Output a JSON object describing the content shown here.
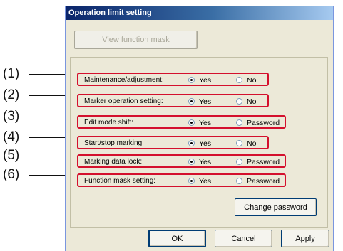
{
  "window": {
    "title": "Operation limit setting"
  },
  "toolbar": {
    "view_function_mask_label": "View function mask"
  },
  "callouts": [
    "(1)",
    "(2)",
    "(3)",
    "(4)",
    "(5)",
    "(6)"
  ],
  "settings": [
    {
      "label": "Maintenance/adjustment:",
      "option_yes": "Yes",
      "option_alt": "No",
      "selected": "Yes"
    },
    {
      "label": "Marker operation setting:",
      "option_yes": "Yes",
      "option_alt": "No",
      "selected": "Yes"
    },
    {
      "label": "Edit mode shift:",
      "option_yes": "Yes",
      "option_alt": "Password",
      "selected": "Yes"
    },
    {
      "label": "Start/stop marking:",
      "option_yes": "Yes",
      "option_alt": "No",
      "selected": "Yes"
    },
    {
      "label": "Marking data lock:",
      "option_yes": "Yes",
      "option_alt": "Password",
      "selected": "Yes"
    },
    {
      "label": "Function mask setting:",
      "option_yes": "Yes",
      "option_alt": "Password",
      "selected": "Yes"
    }
  ],
  "buttons": {
    "change_password": "Change password",
    "ok": "OK",
    "cancel": "Cancel",
    "apply": "Apply"
  },
  "colors": {
    "highlight_border": "#d4102d",
    "dialog_bg": "#ece9d8",
    "title_bar": "#0a246a"
  }
}
